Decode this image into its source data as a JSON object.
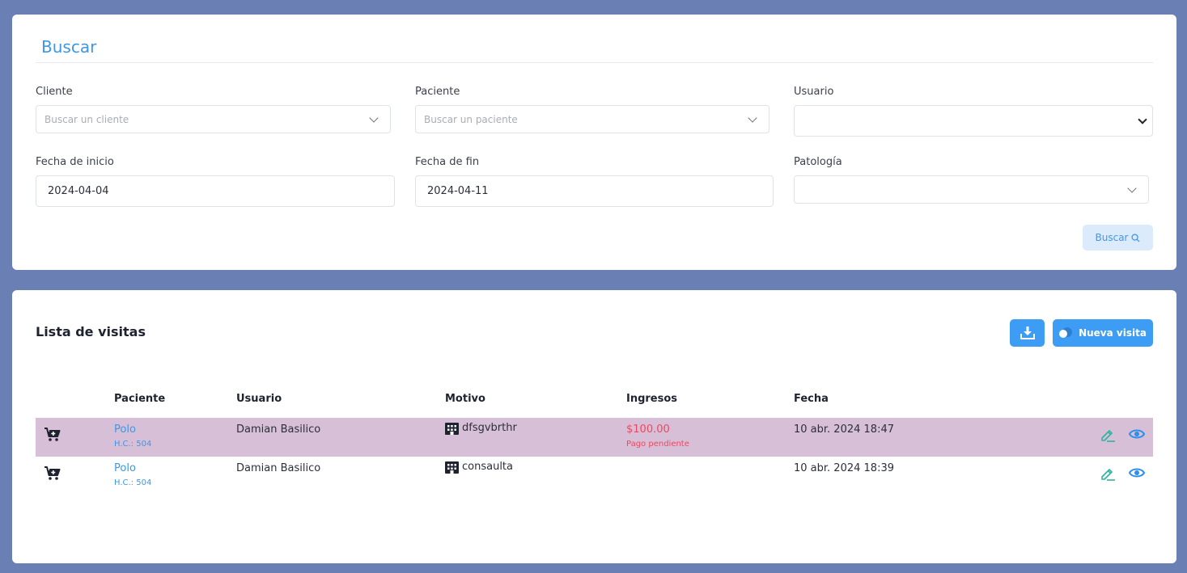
{
  "search": {
    "title": "Buscar",
    "cliente": {
      "label": "Cliente",
      "placeholder": "Buscar un cliente"
    },
    "paciente": {
      "label": "Paciente",
      "placeholder": "Buscar un paciente"
    },
    "usuario": {
      "label": "Usuario",
      "value": ""
    },
    "fecha_inicio": {
      "label": "Fecha de inicio",
      "value": "2024-04-04"
    },
    "fecha_fin": {
      "label": "Fecha de fin",
      "value": "2024-04-11"
    },
    "patologia": {
      "label": "Patología",
      "value": ""
    },
    "button_label": "Buscar"
  },
  "list": {
    "title": "Lista de visitas",
    "new_button_label": "Nueva visita",
    "columns": {
      "paciente": "Paciente",
      "usuario": "Usuario",
      "motivo": "Motivo",
      "ingresos": "Ingresos",
      "fecha": "Fecha"
    },
    "rows": [
      {
        "paciente": "Polo",
        "hc": "H.C.: 504",
        "usuario": "Damian Basilico",
        "motivo": "dfsgvbrthr",
        "ingresos": "$100.00",
        "estado": "Pago pendiente",
        "fecha": "10 abr. 2024 18:47",
        "highlight": true
      },
      {
        "paciente": "Polo",
        "hc": "H.C.: 504",
        "usuario": "Damian Basilico",
        "motivo": "consaulta",
        "ingresos": "",
        "estado": "",
        "fecha": "10 abr. 2024 18:39",
        "highlight": false
      }
    ]
  },
  "colors": {
    "accent": "#3d97e8",
    "button": "#3d9df5",
    "background": "#6a80b4",
    "highlight_row": "#d8bfd8",
    "alert": "#f0475a",
    "edit_icon": "#2bb5a0"
  },
  "icons": {
    "cart": "cart-plus-icon",
    "building": "building-icon",
    "edit": "pencil-icon",
    "view": "eye-icon",
    "download": "download-icon",
    "search": "search-icon",
    "toggle": "toggle-icon"
  }
}
